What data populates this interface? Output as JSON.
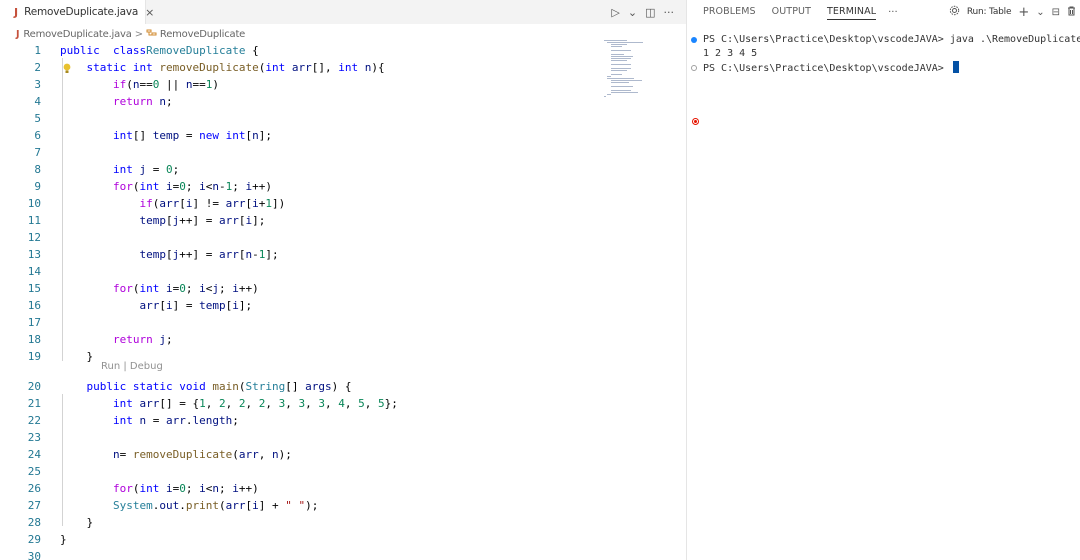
{
  "tab": {
    "language_badge": "J",
    "label": "RemoveDuplicate.java",
    "close_glyph": "×"
  },
  "breadcrumb": {
    "file": "RemoveDuplicate.java",
    "separator": ">",
    "symbol_icon": "class-icon",
    "symbol": "RemoveDuplicate"
  },
  "editor_actions": {
    "run_glyph": "▷",
    "chevron_glyph": "⌄",
    "split_glyph": "◫",
    "more_glyph": "···"
  },
  "codelens": "Run | Debug",
  "code_lines": [
    {
      "n": "1",
      "tokens": [
        [
          "kw",
          "public"
        ],
        [
          "",
          "  "
        ],
        [
          "kw",
          "class"
        ],
        [
          "",
          ""
        ],
        [
          "ty",
          "RemoveDuplicate"
        ],
        [
          "",
          " {"
        ]
      ]
    },
    {
      "n": "2",
      "tokens": [
        [
          "",
          "    "
        ],
        [
          "kw",
          "static"
        ],
        [
          "",
          " "
        ],
        [
          "kw",
          "int"
        ],
        [
          "",
          " "
        ],
        [
          "fn",
          "removeDuplicate"
        ],
        [
          "",
          "("
        ],
        [
          "kw",
          "int"
        ],
        [
          "",
          " "
        ],
        [
          "var",
          "arr"
        ],
        [
          "",
          "[], "
        ],
        [
          "kw",
          "int"
        ],
        [
          "",
          " "
        ],
        [
          "var",
          "n"
        ],
        [
          "",
          "){"
        ]
      ]
    },
    {
      "n": "3",
      "tokens": [
        [
          "",
          "        "
        ],
        [
          "ctl",
          "if"
        ],
        [
          "",
          "("
        ],
        [
          "var",
          "n"
        ],
        [
          "",
          "=="
        ],
        [
          "num",
          "0"
        ],
        [
          "",
          " || "
        ],
        [
          "var",
          "n"
        ],
        [
          "",
          "=="
        ],
        [
          "num",
          "1"
        ],
        [
          "",
          ")"
        ]
      ]
    },
    {
      "n": "4",
      "tokens": [
        [
          "",
          "        "
        ],
        [
          "ctl",
          "return"
        ],
        [
          "",
          " "
        ],
        [
          "var",
          "n"
        ],
        [
          "",
          ";"
        ]
      ]
    },
    {
      "n": "5",
      "tokens": []
    },
    {
      "n": "6",
      "tokens": [
        [
          "",
          "        "
        ],
        [
          "kw",
          "int"
        ],
        [
          "",
          "[] "
        ],
        [
          "var",
          "temp"
        ],
        [
          "",
          " = "
        ],
        [
          "kw",
          "new"
        ],
        [
          "",
          " "
        ],
        [
          "kw",
          "int"
        ],
        [
          "",
          "["
        ],
        [
          "var",
          "n"
        ],
        [
          "",
          "];"
        ]
      ]
    },
    {
      "n": "7",
      "tokens": []
    },
    {
      "n": "8",
      "tokens": [
        [
          "",
          "        "
        ],
        [
          "kw",
          "int"
        ],
        [
          "",
          " "
        ],
        [
          "var",
          "j"
        ],
        [
          "",
          " = "
        ],
        [
          "num",
          "0"
        ],
        [
          "",
          ";"
        ]
      ]
    },
    {
      "n": "9",
      "tokens": [
        [
          "",
          "        "
        ],
        [
          "ctl",
          "for"
        ],
        [
          "",
          "("
        ],
        [
          "kw",
          "int"
        ],
        [
          "",
          " "
        ],
        [
          "var",
          "i"
        ],
        [
          "",
          "="
        ],
        [
          "num",
          "0"
        ],
        [
          "",
          "; "
        ],
        [
          "var",
          "i"
        ],
        [
          "",
          "<"
        ],
        [
          "var",
          "n"
        ],
        [
          "",
          "-"
        ],
        [
          "num",
          "1"
        ],
        [
          "",
          "; "
        ],
        [
          "var",
          "i"
        ],
        [
          "",
          "++)"
        ]
      ]
    },
    {
      "n": "10",
      "tokens": [
        [
          "",
          "            "
        ],
        [
          "ctl",
          "if"
        ],
        [
          "",
          "("
        ],
        [
          "var",
          "arr"
        ],
        [
          "",
          "["
        ],
        [
          "var",
          "i"
        ],
        [
          "",
          "] != "
        ],
        [
          "var",
          "arr"
        ],
        [
          "",
          "["
        ],
        [
          "var",
          "i"
        ],
        [
          "",
          "+"
        ],
        [
          "num",
          "1"
        ],
        [
          "",
          "])"
        ]
      ]
    },
    {
      "n": "11",
      "tokens": [
        [
          "",
          "            "
        ],
        [
          "var",
          "temp"
        ],
        [
          "",
          "["
        ],
        [
          "var",
          "j"
        ],
        [
          "",
          "++] = "
        ],
        [
          "var",
          "arr"
        ],
        [
          "",
          "["
        ],
        [
          "var",
          "i"
        ],
        [
          "",
          "];"
        ]
      ]
    },
    {
      "n": "12",
      "tokens": []
    },
    {
      "n": "13",
      "tokens": [
        [
          "",
          "            "
        ],
        [
          "var",
          "temp"
        ],
        [
          "",
          "["
        ],
        [
          "var",
          "j"
        ],
        [
          "",
          "++] = "
        ],
        [
          "var",
          "arr"
        ],
        [
          "",
          "["
        ],
        [
          "var",
          "n"
        ],
        [
          "",
          "-"
        ],
        [
          "num",
          "1"
        ],
        [
          "",
          "];"
        ]
      ]
    },
    {
      "n": "14",
      "tokens": []
    },
    {
      "n": "15",
      "tokens": [
        [
          "",
          "        "
        ],
        [
          "ctl",
          "for"
        ],
        [
          "",
          "("
        ],
        [
          "kw",
          "int"
        ],
        [
          "",
          " "
        ],
        [
          "var",
          "i"
        ],
        [
          "",
          "="
        ],
        [
          "num",
          "0"
        ],
        [
          "",
          "; "
        ],
        [
          "var",
          "i"
        ],
        [
          "",
          "<"
        ],
        [
          "var",
          "j"
        ],
        [
          "",
          "; "
        ],
        [
          "var",
          "i"
        ],
        [
          "",
          "++)"
        ]
      ]
    },
    {
      "n": "16",
      "tokens": [
        [
          "",
          "            "
        ],
        [
          "var",
          "arr"
        ],
        [
          "",
          "["
        ],
        [
          "var",
          "i"
        ],
        [
          "",
          "] = "
        ],
        [
          "var",
          "temp"
        ],
        [
          "",
          "["
        ],
        [
          "var",
          "i"
        ],
        [
          "",
          "];"
        ]
      ]
    },
    {
      "n": "17",
      "tokens": []
    },
    {
      "n": "18",
      "tokens": [
        [
          "",
          "        "
        ],
        [
          "ctl",
          "return"
        ],
        [
          "",
          " "
        ],
        [
          "var",
          "j"
        ],
        [
          "",
          ";"
        ]
      ]
    },
    {
      "n": "19",
      "tokens": [
        [
          "",
          "    "
        ],
        [
          "",
          "}"
        ]
      ]
    },
    {
      "n": "20",
      "tokens": [
        [
          "",
          "    "
        ],
        [
          "kw",
          "public"
        ],
        [
          "",
          " "
        ],
        [
          "kw",
          "static"
        ],
        [
          "",
          " "
        ],
        [
          "kw",
          "void"
        ],
        [
          "",
          " "
        ],
        [
          "fn",
          "main"
        ],
        [
          "",
          "("
        ],
        [
          "ty",
          "String"
        ],
        [
          "",
          "[] "
        ],
        [
          "var",
          "args"
        ],
        [
          "",
          ") {"
        ]
      ]
    },
    {
      "n": "21",
      "tokens": [
        [
          "",
          "        "
        ],
        [
          "kw",
          "int"
        ],
        [
          "",
          " "
        ],
        [
          "var",
          "arr"
        ],
        [
          "",
          "[] = {"
        ],
        [
          "num",
          "1"
        ],
        [
          "",
          ", "
        ],
        [
          "num",
          "2"
        ],
        [
          "",
          ", "
        ],
        [
          "num",
          "2"
        ],
        [
          "",
          ", "
        ],
        [
          "num",
          "2"
        ],
        [
          "",
          ", "
        ],
        [
          "num",
          "3"
        ],
        [
          "",
          ", "
        ],
        [
          "num",
          "3"
        ],
        [
          "",
          ", "
        ],
        [
          "num",
          "3"
        ],
        [
          "",
          ", "
        ],
        [
          "num",
          "4"
        ],
        [
          "",
          ", "
        ],
        [
          "num",
          "5"
        ],
        [
          "",
          ", "
        ],
        [
          "num",
          "5"
        ],
        [
          "",
          "};"
        ]
      ]
    },
    {
      "n": "22",
      "tokens": [
        [
          "",
          "        "
        ],
        [
          "kw",
          "int"
        ],
        [
          "",
          " "
        ],
        [
          "var",
          "n"
        ],
        [
          "",
          " = "
        ],
        [
          "var",
          "arr"
        ],
        [
          "",
          "."
        ],
        [
          "var",
          "length"
        ],
        [
          "",
          ";"
        ]
      ]
    },
    {
      "n": "23",
      "tokens": []
    },
    {
      "n": "24",
      "tokens": [
        [
          "",
          "        "
        ],
        [
          "var",
          "n"
        ],
        [
          "",
          "= "
        ],
        [
          "fn",
          "removeDuplicate"
        ],
        [
          "",
          "("
        ],
        [
          "var",
          "arr"
        ],
        [
          "",
          ", "
        ],
        [
          "var",
          "n"
        ],
        [
          "",
          ");"
        ]
      ]
    },
    {
      "n": "25",
      "tokens": []
    },
    {
      "n": "26",
      "tokens": [
        [
          "",
          "        "
        ],
        [
          "ctl",
          "for"
        ],
        [
          "",
          "("
        ],
        [
          "kw",
          "int"
        ],
        [
          "",
          " "
        ],
        [
          "var",
          "i"
        ],
        [
          "",
          "="
        ],
        [
          "num",
          "0"
        ],
        [
          "",
          "; "
        ],
        [
          "var",
          "i"
        ],
        [
          "",
          "<"
        ],
        [
          "var",
          "n"
        ],
        [
          "",
          "; "
        ],
        [
          "var",
          "i"
        ],
        [
          "",
          "++)"
        ]
      ]
    },
    {
      "n": "27",
      "tokens": [
        [
          "",
          "        "
        ],
        [
          "ty",
          "System"
        ],
        [
          "",
          "."
        ],
        [
          "var",
          "out"
        ],
        [
          "",
          "."
        ],
        [
          "fn",
          "print"
        ],
        [
          "",
          "("
        ],
        [
          "var",
          "arr"
        ],
        [
          "",
          "["
        ],
        [
          "var",
          "i"
        ],
        [
          "",
          "] + "
        ],
        [
          "str",
          "\" \""
        ],
        [
          "",
          ");"
        ]
      ]
    },
    {
      "n": "28",
      "tokens": [
        [
          "",
          "    "
        ],
        [
          "",
          "}"
        ]
      ]
    },
    {
      "n": "29",
      "tokens": [
        [
          "",
          "}"
        ]
      ]
    },
    {
      "n": "30",
      "tokens": []
    }
  ],
  "panel": {
    "tabs": [
      "PROBLEMS",
      "OUTPUT",
      "TERMINAL"
    ],
    "active_tab": "TERMINAL",
    "more_glyph": "···",
    "run_icon": "gear-icon",
    "run_label": "Run: Table",
    "add_glyph": "+",
    "chevron_glyph": "⌄",
    "split_glyph": "⊟",
    "trash_icon": "trash-icon"
  },
  "terminal": {
    "prompt1": "PS C:\\Users\\Practice\\Desktop\\vscodeJAVA> java .\\RemoveDuplicate.java",
    "output": "1 2 3 4 5",
    "prompt2": "PS C:\\Users\\Practice\\Desktop\\vscodeJAVA> "
  },
  "colors": {
    "keyword": "#0000ff",
    "control": "#af00db",
    "type": "#267f99",
    "function": "#795e26",
    "variable": "#001080",
    "number": "#098658",
    "string": "#a31515",
    "line_number": "#237893",
    "terminal_cursor": "#0451a5",
    "success_dot": "#1a85ff",
    "error_dot": "#e51400"
  }
}
